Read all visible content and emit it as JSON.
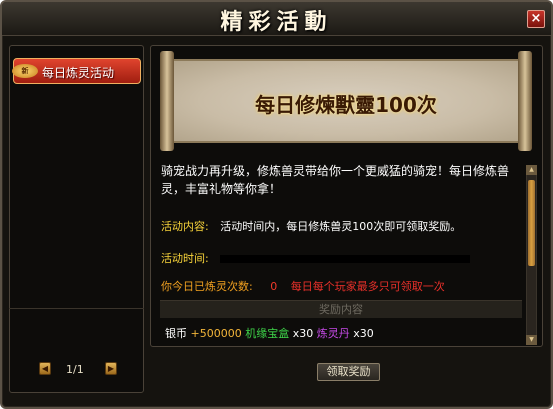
{
  "window": {
    "title": "精彩活動",
    "close_label": "×"
  },
  "sidebar": {
    "tab_badge": "新",
    "tabs": [
      {
        "label": "每日炼灵活动"
      }
    ],
    "pager": {
      "prev_icon": "◀",
      "next_icon": "▶",
      "page": "1/1"
    }
  },
  "banner": {
    "title": "每日修煉獸靈100次"
  },
  "content": {
    "description": "骑宠战力再升级，修炼兽灵带给你一个更威猛的骑宠！每日修炼兽灵，丰富礼物等你拿！",
    "activity_label": "活动内容:",
    "activity_text": "活动时间内，每日修炼兽灵100次即可领取奖励。",
    "time_label": "活动时间:",
    "count_label": "你今日已炼灵次数:",
    "count_value": "0",
    "count_note": "每日每个玩家最多只可领取一次"
  },
  "rewards": {
    "header": "奖励内容",
    "silver_label": "银币",
    "silver_amount": "+500000",
    "box_name": "机缘宝盒",
    "box_count": "x30",
    "pill_name": "炼灵丹",
    "pill_count": "x30"
  },
  "actions": {
    "claim_label": "领取奖励"
  },
  "scroll": {
    "up_icon": "▲",
    "down_icon": "▼"
  }
}
